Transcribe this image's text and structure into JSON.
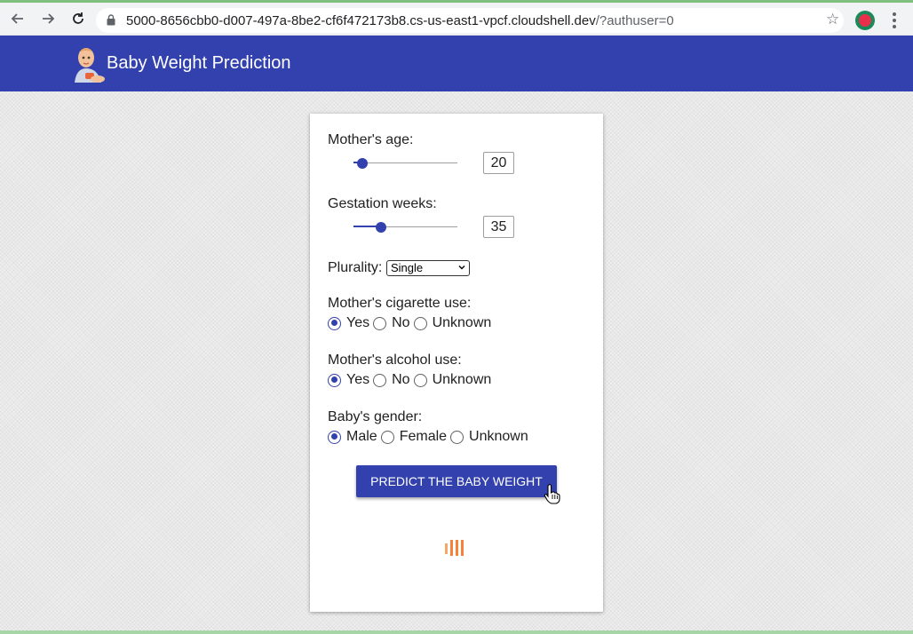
{
  "browser": {
    "url_host": "5000-8656cbb0-d007-497a-8be2-cf6f472173b8.cs-us-east1-vpcf.cloudshell.dev",
    "url_rest": "/?authuser=0",
    "icons": [
      "back-arrow-icon",
      "forward-arrow-icon",
      "reload-icon",
      "lock-icon",
      "star-icon",
      "profile-icon",
      "menu-icon"
    ]
  },
  "app": {
    "title": "Baby Weight Prediction",
    "bar_color": "#3241ad"
  },
  "form": {
    "mother_age": {
      "label": "Mother's age:",
      "value": "20",
      "slider_level": 0.1
    },
    "gestation": {
      "label": "Gestation weeks:",
      "value": "35",
      "slider_level": 0.27
    },
    "plurality": {
      "label": "Plurality:",
      "selected": "Single"
    },
    "cigarette": {
      "label": "Mother's cigarette use:",
      "options": [
        "Yes",
        "No",
        "Unknown"
      ],
      "selected": "Yes"
    },
    "alcohol": {
      "label": "Mother's alcohol use:",
      "options": [
        "Yes",
        "No",
        "Unknown"
      ],
      "selected": "Yes"
    },
    "gender": {
      "label": "Baby's gender:",
      "options": [
        "Male",
        "Female",
        "Unknown"
      ],
      "selected": "Male"
    },
    "predict_button": "PREDICT THE BABY WEIGHT"
  },
  "colors": {
    "accent": "#3241ad",
    "loader": "#f5813a"
  }
}
